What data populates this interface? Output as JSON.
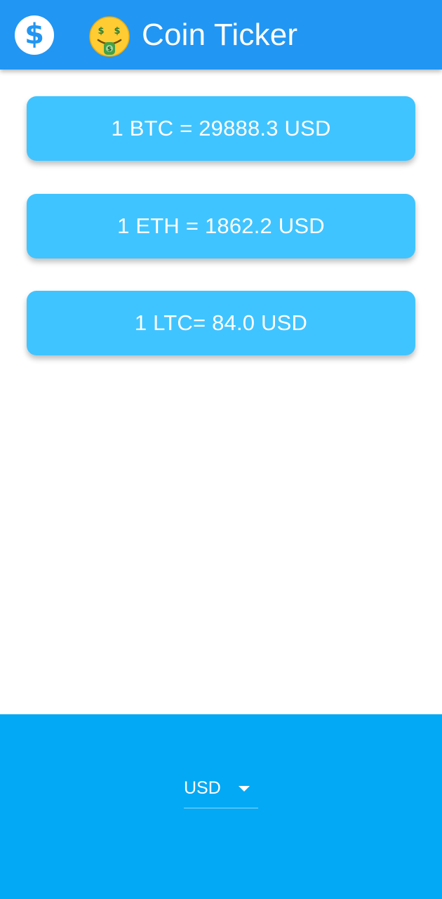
{
  "app_bar": {
    "title": "Coin Ticker",
    "leading_icon": "dollar-circle-icon",
    "title_emoji": "money-mouth-face-icon",
    "background_color": "#2196f3"
  },
  "rates": [
    {
      "label": "1 BTC = 29888.3 USD"
    },
    {
      "label": "1 ETH = 1862.2 USD"
    },
    {
      "label": "1 LTC= 84.0 USD"
    }
  ],
  "card_color": "#40c4ff",
  "bottom_panel": {
    "background_color": "#03a9f4",
    "currency_dropdown": {
      "selected": "USD",
      "icon": "caret-down-icon"
    }
  }
}
